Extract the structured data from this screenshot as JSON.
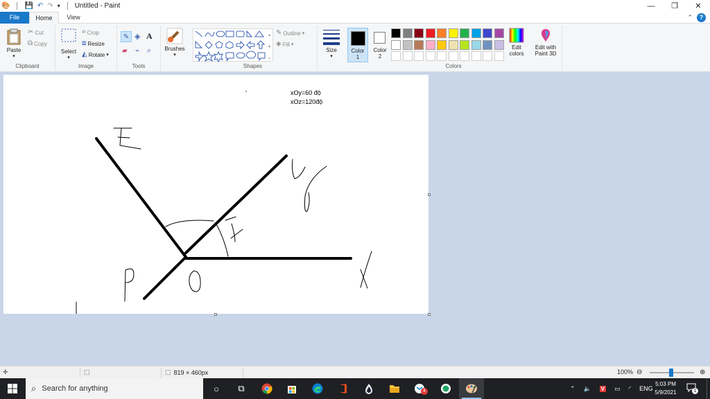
{
  "window": {
    "title": "Untitled - Paint"
  },
  "tabs": {
    "file": "File",
    "home": "Home",
    "view": "View"
  },
  "clipboard": {
    "label": "Clipboard",
    "paste": "Paste",
    "cut": "Cut",
    "copy": "Copy"
  },
  "image": {
    "label": "Image",
    "select": "Select",
    "crop": "Crop",
    "resize": "Resize",
    "rotate": "Rotate"
  },
  "tools": {
    "label": "Tools",
    "text_tool": "A"
  },
  "brushes": {
    "label": "Brushes"
  },
  "shapes": {
    "label": "Shapes",
    "outline": "Outline",
    "fill": "Fill"
  },
  "size": {
    "label": "Size"
  },
  "colors": {
    "label": "Colors",
    "color1": "Color\n1",
    "color2": "Color\n2",
    "edit_colors": "Edit colors",
    "edit_paint3d": "Edit with Paint 3D",
    "color1_value": "#000000",
    "color2_value": "#ffffff",
    "palette_row1": [
      "#000000",
      "#7f7f7f",
      "#880015",
      "#ed1c24",
      "#ff7f27",
      "#fff200",
      "#22b14c",
      "#00a2e8",
      "#3f48cc",
      "#a349a4"
    ],
    "palette_row2": [
      "#ffffff",
      "#c3c3c3",
      "#b97a57",
      "#ffaec9",
      "#ffc90e",
      "#efe4b0",
      "#b5e61d",
      "#99d9ea",
      "#7092be",
      "#c8bfe7"
    ],
    "palette_row3": [
      "#ffffff",
      "#ffffff",
      "#ffffff",
      "#ffffff",
      "#ffffff",
      "#ffffff",
      "#ffffff",
      "#ffffff",
      "#ffffff",
      "#ffffff"
    ]
  },
  "canvas_text": {
    "line1": "xOy=60 độ",
    "line2": "xOz=120độ"
  },
  "status": {
    "dimensions": "819 × 460px",
    "zoom": "100%"
  },
  "taskbar": {
    "search_placeholder": "Search for anything",
    "mail_badge": "4",
    "language": "ENG",
    "time": "5:03 PM",
    "date": "5/9/2021",
    "notification_count": "1"
  }
}
